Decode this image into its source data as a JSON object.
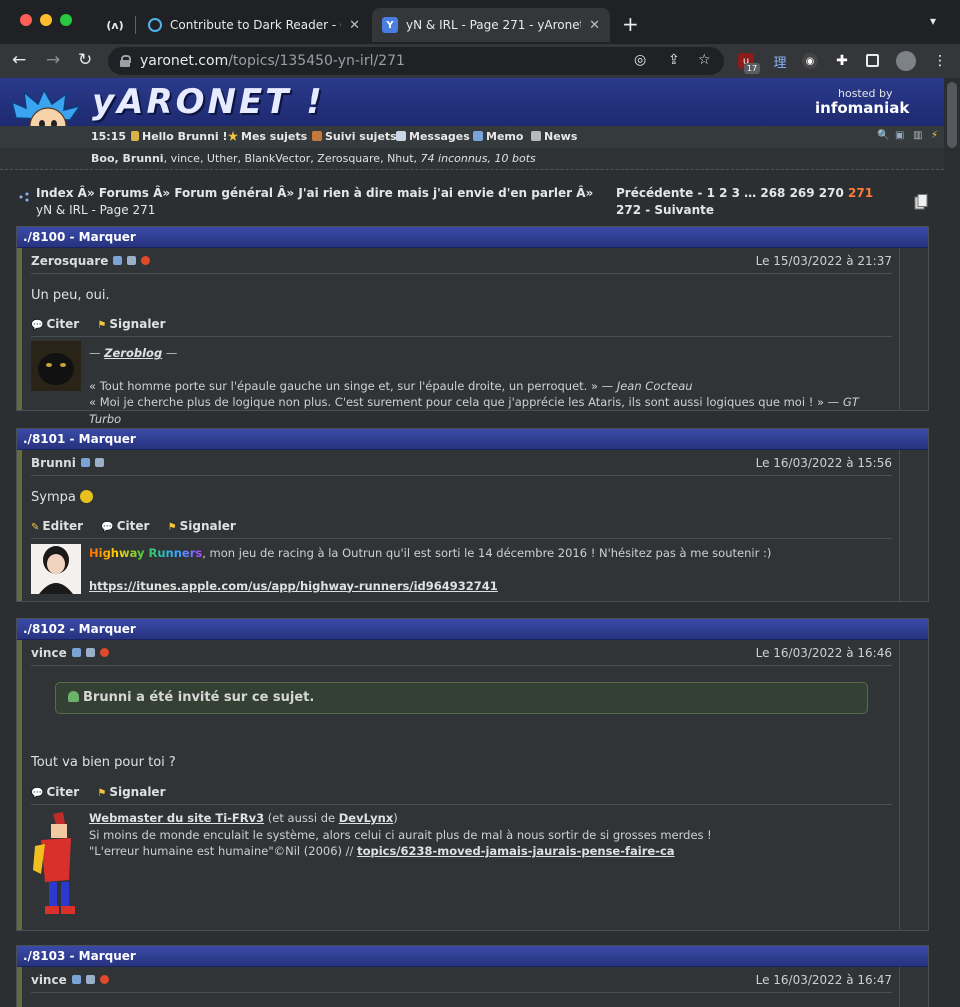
{
  "browser": {
    "tabs": [
      {
        "title": "(ʌ)"
      },
      {
        "title": "Contribute to Dark Reader - Op"
      },
      {
        "title": "yN & IRL - Page 271 - yAronet"
      }
    ],
    "url_host": "yaronet.com",
    "url_path": "/topics/135450-yn-irl/271",
    "ext_badge": "17"
  },
  "site": {
    "logo": "yARONET !",
    "hosted_by": "hosted by",
    "host_name": "infomaniak",
    "nav": {
      "time": "15:15",
      "hello": "Hello Brunni !",
      "mes_sujets": "Mes sujets",
      "suivi_sujets": "Suivi sujets",
      "messages": "Messages",
      "memo": "Memo",
      "news": "News"
    },
    "online": {
      "bold_users": "Boo, Brunni",
      "users": ", vince, Uther, BlankVector, Zerosquare, Nhut, ",
      "count": "74 inconnus, 10 bots"
    },
    "breadcrumb": {
      "path": "Index Â» Forums Â» Forum général Â» J'ai rien à dire mais j'ai envie d'en parler Â» ",
      "current": "yN & IRL - Page 271"
    },
    "pagination": {
      "prev": "Précédente - 1 2 3 … 268 269 270 ",
      "current": "271",
      "next": " 272 - Suivante"
    }
  },
  "posts": [
    {
      "header": "./8100 - Marquer",
      "author": "Zerosquare",
      "date": "Le 15/03/2022 à 21:37",
      "message": "Un peu, oui.",
      "actions": [
        "Citer",
        "Signaler"
      ],
      "sig_title": "Zeroblog",
      "sig_line1": "« Tout homme porte sur l'épaule gauche un singe et, sur l'épaule droite, un perroquet. » — ",
      "sig_line1_author": "Jean Cocteau",
      "sig_line2": "« Moi je cherche plus de logique non plus. C'est surement pour cela que j'apprécie les Ataris, ils sont aussi logiques que moi ! » — ",
      "sig_line2_author": "GT Turbo"
    },
    {
      "header": "./8101 - Marquer",
      "author": "Brunni",
      "date": "Le 16/03/2022 à 15:56",
      "message": "Sympa",
      "actions": [
        "Editer",
        "Citer",
        "Signaler"
      ],
      "sig_game": "Highway Runners",
      "sig_text": ", mon jeu de racing à la Outrun qu'il est sorti le 14 décembre 2016 ! N'hésitez pas à me soutenir :)",
      "sig_link": "https://itunes.apple.com/us/app/highway-runners/id964932741"
    },
    {
      "header": "./8102 - Marquer",
      "author": "vince",
      "date": "Le 16/03/2022 à 16:46",
      "invite": "Brunni a été invité sur ce sujet.",
      "message": "Tout va bien pour toi ?",
      "actions": [
        "Citer",
        "Signaler"
      ],
      "sig_link1": "Webmaster du site Ti-FRv3",
      "sig_mid": " (et aussi de ",
      "sig_link2": "DevLynx",
      "sig_end": ")",
      "sig_line2": "Si moins de monde enculait le système, alors celui ci aurait plus de mal à nous sortir de si grosses merdes !",
      "sig_line3": "\"L'erreur humaine est humaine\"©Nil (2006) // ",
      "sig_link3": "topics/6238-moved-jamais-jaurais-pense-faire-ca"
    },
    {
      "header": "./8103 - Marquer",
      "author": "vince",
      "date": "Le 16/03/2022 à 16:47"
    }
  ],
  "colors": {
    "header_blue": "#2d3b96",
    "current_page": "#ff7a3c",
    "left_accent": "#656b3a"
  }
}
